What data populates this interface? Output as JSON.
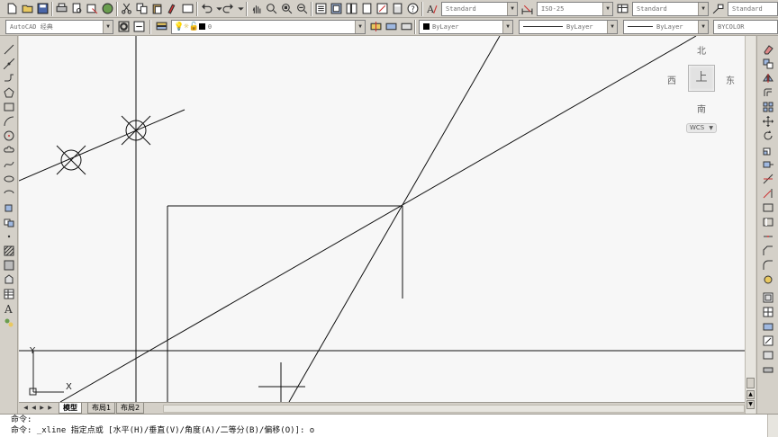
{
  "toolbar": {
    "text_style": "Standard",
    "dim_style": "ISO-25",
    "table_style": "Standard",
    "multileader_style": "Standard"
  },
  "properties": {
    "workspace": "AutoCAD 经典",
    "layer": "0",
    "color": "ByLayer",
    "linetype": "ByLayer",
    "lineweight": "ByLayer",
    "plot_style": "BYCOLOR"
  },
  "viewcube": {
    "north": "北",
    "south": "南",
    "east": "东",
    "west": "西",
    "face": "上",
    "coord_system": "WCS"
  },
  "ucs": {
    "x_label": "X",
    "y_label": "Y"
  },
  "tabs": [
    {
      "label": "模型",
      "active": true
    },
    {
      "label": "布局1",
      "active": false
    },
    {
      "label": "布局2",
      "active": false
    }
  ],
  "command": {
    "line1": "命令:",
    "line2": "命令: _xline 指定点或 [水平(H)/垂直(V)/角度(A)/二等分(B)/偏移(O)]: o"
  }
}
